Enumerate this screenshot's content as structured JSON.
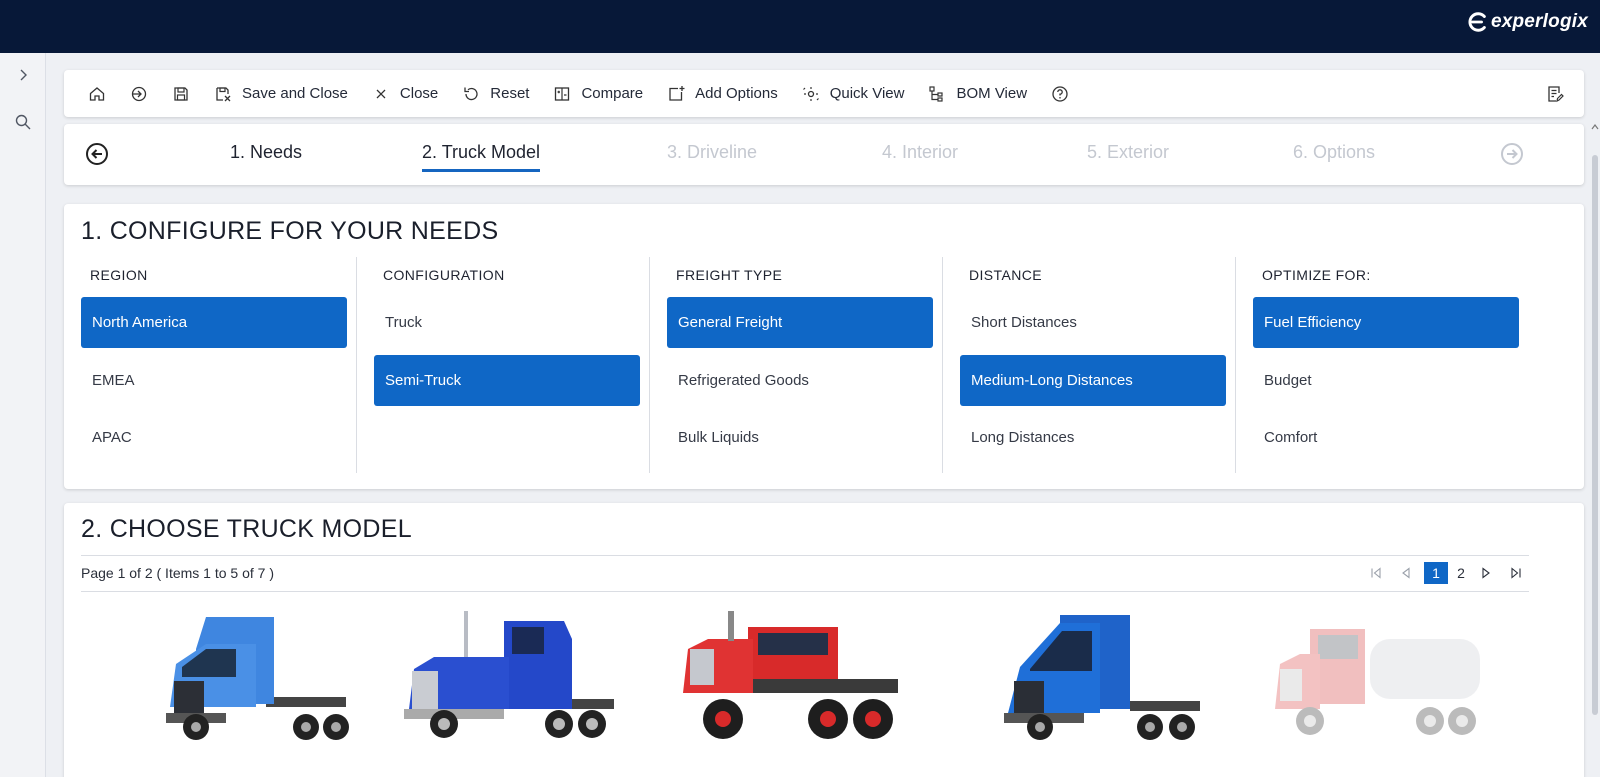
{
  "brand": {
    "name": "experlogix"
  },
  "toolbar": {
    "items": [
      {
        "label": "",
        "icon": "home-icon"
      },
      {
        "label": "",
        "icon": "sign-in-icon"
      },
      {
        "label": "",
        "icon": "save-icon"
      },
      {
        "label": "Save and Close",
        "icon": "save-close-icon"
      },
      {
        "label": "Close",
        "icon": "close-icon"
      },
      {
        "label": "Reset",
        "icon": "reset-icon"
      },
      {
        "label": "Compare",
        "icon": "compare-icon"
      },
      {
        "label": "Add Options",
        "icon": "add-options-icon"
      },
      {
        "label": "Quick View",
        "icon": "quick-view-icon"
      },
      {
        "label": "BOM View",
        "icon": "bom-view-icon"
      },
      {
        "label": "",
        "icon": "help-icon"
      }
    ]
  },
  "steps": [
    {
      "label": "1. Needs",
      "state": "done"
    },
    {
      "label": "2. Truck Model",
      "state": "active"
    },
    {
      "label": "3. Driveline",
      "state": "disabled"
    },
    {
      "label": "4. Interior",
      "state": "disabled"
    },
    {
      "label": "5. Exterior",
      "state": "disabled"
    },
    {
      "label": "6. Options",
      "state": "disabled"
    }
  ],
  "needs": {
    "title": "1. CONFIGURE FOR YOUR NEEDS",
    "columns": [
      {
        "heading": "REGION",
        "options": [
          "North America",
          "EMEA",
          "APAC"
        ],
        "selected": 0
      },
      {
        "heading": "CONFIGURATION",
        "options": [
          "Truck",
          "Semi-Truck"
        ],
        "selected": 1
      },
      {
        "heading": "FREIGHT TYPE",
        "options": [
          "General Freight",
          "Refrigerated Goods",
          "Bulk Liquids"
        ],
        "selected": 0
      },
      {
        "heading": "DISTANCE",
        "options": [
          "Short Distances",
          "Medium-Long Distances",
          "Long Distances"
        ],
        "selected": 1
      },
      {
        "heading": "OPTIMIZE FOR:",
        "options": [
          "Fuel Efficiency",
          "Budget",
          "Comfort"
        ],
        "selected": 0
      }
    ]
  },
  "models": {
    "title": "2. CHOOSE TRUCK MODEL",
    "page_info": "Page 1 of 2 ( Items 1 to 5 of 7 )",
    "pages": [
      "1",
      "2"
    ],
    "current_page": "1",
    "trucks": [
      {
        "name": "light-blue-day-cab-truck",
        "cab_color": "#3f86e0",
        "faded": false
      },
      {
        "name": "blue-long-hood-sleeper-truck",
        "cab_color": "#2448c9",
        "faded": false
      },
      {
        "name": "red-heavy-haul-truck",
        "cab_color": "#d82a2a",
        "faded": false
      },
      {
        "name": "blue-aero-sleeper-truck",
        "cab_color": "#1f63c9",
        "faded": false
      },
      {
        "name": "red-tanker-truck",
        "cab_color": "#d32f2f",
        "faded": true
      }
    ]
  },
  "colors": {
    "topbar": "#071838",
    "accent": "#0f67c6"
  }
}
